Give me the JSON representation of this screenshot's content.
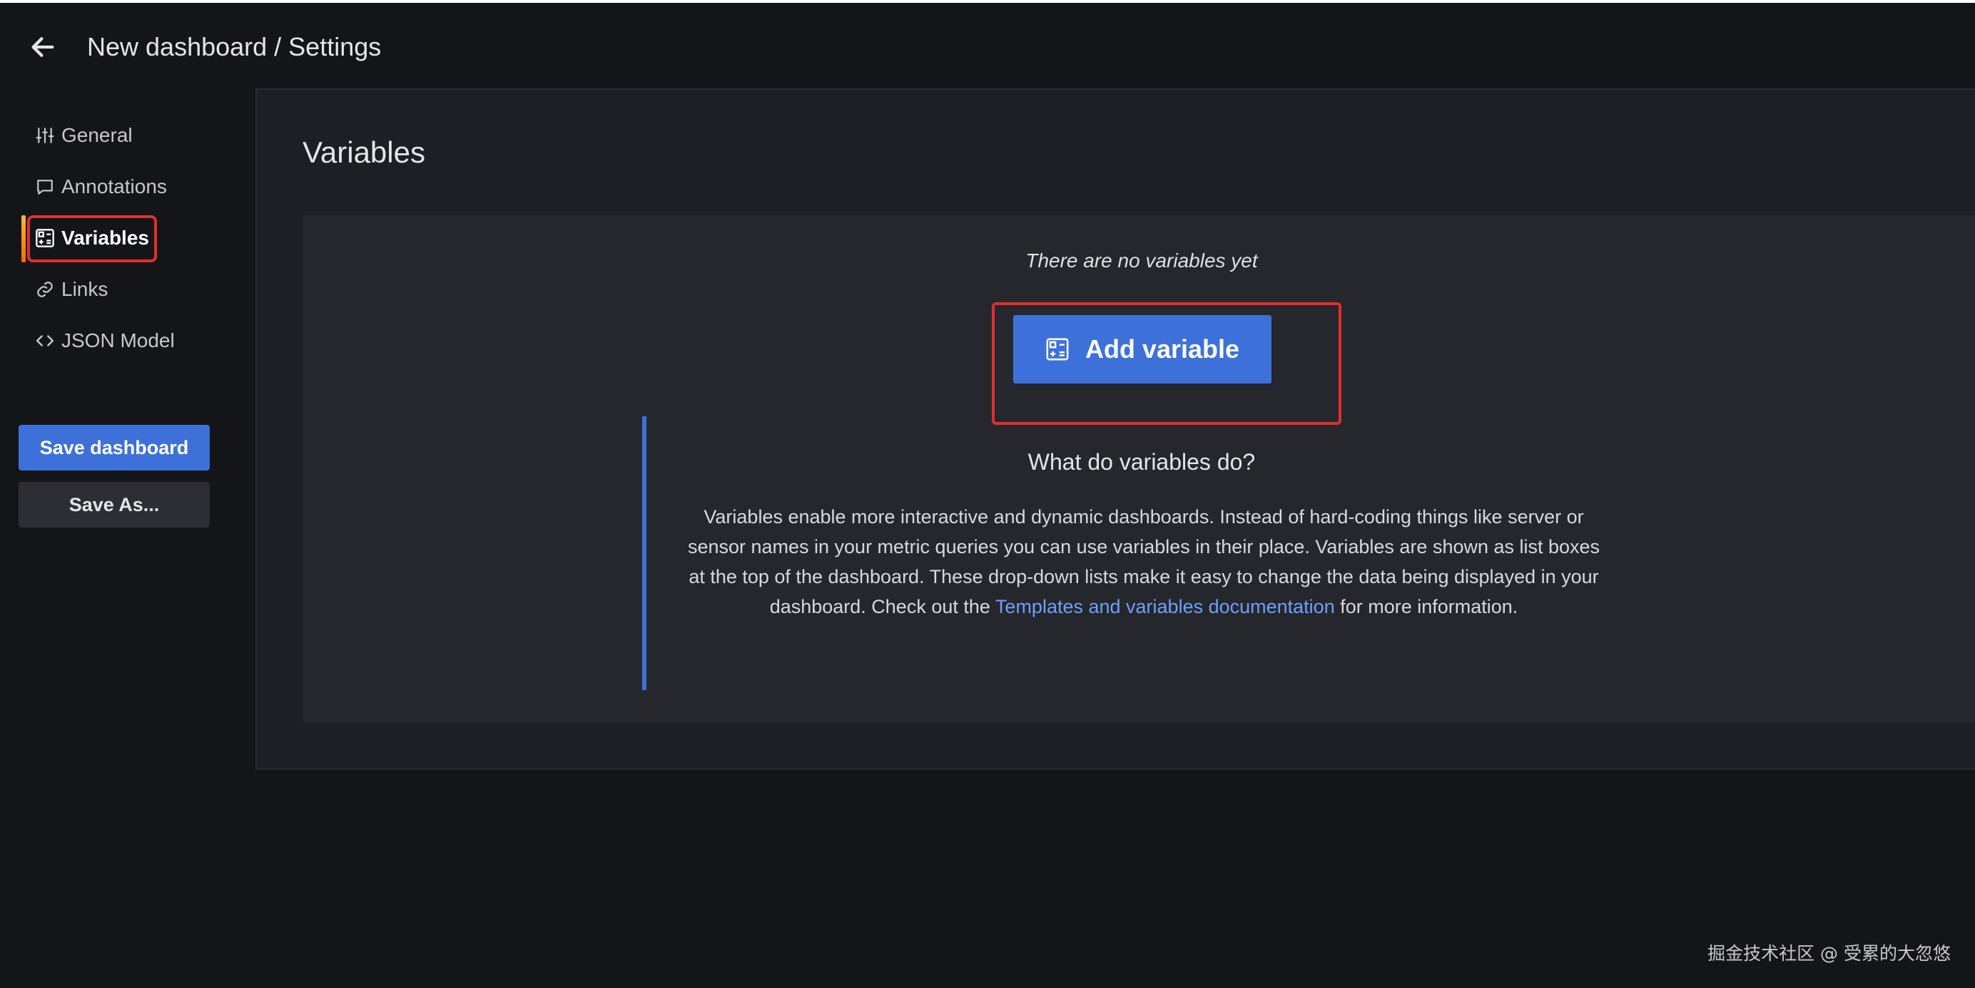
{
  "header": {
    "title": "New dashboard / Settings"
  },
  "sidebar": {
    "items": [
      {
        "label": "General",
        "icon": "sliders-icon"
      },
      {
        "label": "Annotations",
        "icon": "comment-icon"
      },
      {
        "label": "Variables",
        "icon": "calculator-icon",
        "active": true
      },
      {
        "label": "Links",
        "icon": "link-icon"
      },
      {
        "label": "JSON Model",
        "icon": "code-icon"
      }
    ],
    "save_label": "Save dashboard",
    "save_as_label": "Save As..."
  },
  "main": {
    "title": "Variables",
    "empty_text": "There are no variables yet",
    "add_button_label": "Add variable",
    "info_heading": "What do variables do?",
    "info_text_before": "Variables enable more interactive and dynamic dashboards. Instead of hard-coding things like server or sensor names in your metric queries you can use variables in their place. Variables are shown as list boxes at the top of the dashboard. These drop-down lists make it easy to change the data being displayed in your dashboard. Check out the ",
    "info_link": "Templates and variables documentation",
    "info_text_after": " for more information."
  },
  "watermark": "掘金技术社区 @ 受累的大忽悠",
  "colors": {
    "accent": "#3d71d9",
    "highlight": "#e02f2f",
    "link": "#6e9fff"
  }
}
